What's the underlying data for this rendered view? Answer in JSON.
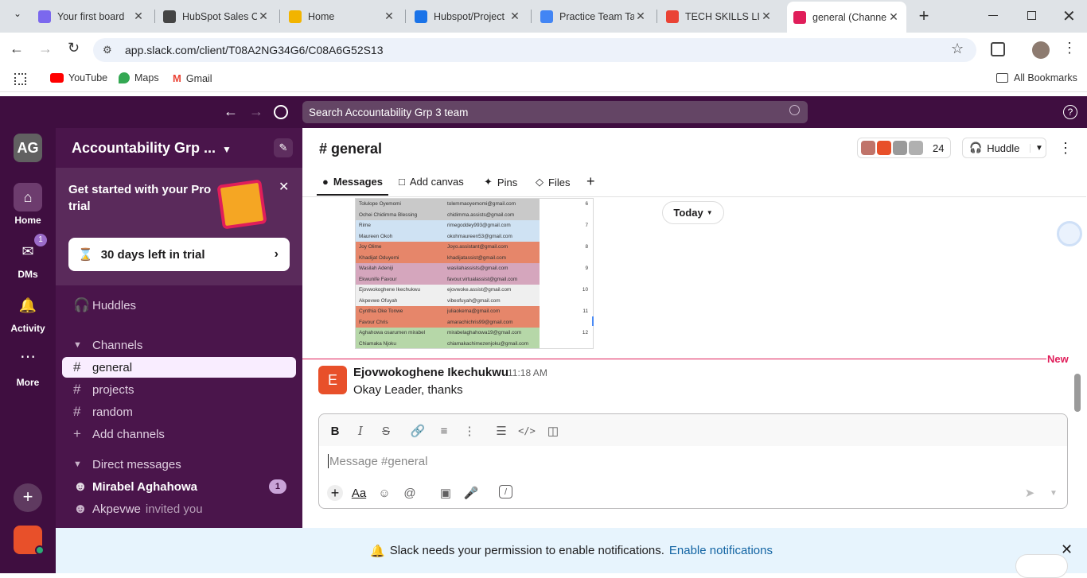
{
  "browser": {
    "tabs": [
      {
        "title": "Your first board",
        "icon_color": "#7b68ee"
      },
      {
        "title": "HubSpot Sales C",
        "icon_color": "#444444"
      },
      {
        "title": "Home",
        "icon_color": "#f2b400"
      },
      {
        "title": "Hubspot/Project",
        "icon_color": "#1a73e8"
      },
      {
        "title": "Practice Team Ta",
        "icon_color": "#4285f4"
      },
      {
        "title": "TECH SKILLS LIN",
        "icon_color": "#ea4335"
      },
      {
        "title": "general (Channe",
        "icon_color": "#e01e5a"
      }
    ],
    "url": "app.slack.com/client/T08A2NG34G6/C08A6G52S13",
    "bookmarks": [
      "YouTube",
      "Maps",
      "Gmail"
    ],
    "all_bookmarks": "All Bookmarks"
  },
  "slack": {
    "search_placeholder": "Search Accountability Grp 3 team",
    "workspace_initials": "AG",
    "workspace_name": "Accountability Grp ...",
    "rail": {
      "home": "Home",
      "dms": "DMs",
      "dms_badge": "1",
      "activity": "Activity",
      "more": "More"
    },
    "promo": {
      "title": "Get started with your Pro trial",
      "trial_label": "30 days left in trial"
    },
    "huddles": "Huddles",
    "channels_header": "Channels",
    "channels": [
      "general",
      "projects",
      "random"
    ],
    "add_channels": "Add channels",
    "dm_header": "Direct messages",
    "dms": [
      {
        "name": "Mirabel Aghahowa",
        "badge": "1",
        "note": ""
      },
      {
        "name": "Akpevwe",
        "badge": "",
        "note": "invited you"
      }
    ],
    "channel": {
      "name": "# general",
      "member_count": "24",
      "huddle": "Huddle"
    },
    "tabs": [
      "Messages",
      "Add canvas",
      "Pins",
      "Files"
    ],
    "date_divider": "Today",
    "new_label": "New",
    "message": {
      "author": "Ejovwokoghene Ikechukwu",
      "avatar": "E",
      "time": "11:18 AM",
      "text": "Okay Leader, thanks"
    },
    "composer_placeholder": "Message #general",
    "notification": {
      "text": "Slack needs your permission to enable notifications.",
      "link": "Enable notifications"
    },
    "sheet_rows": [
      {
        "name": "Tolulope Oyemomi",
        "email": "tolemmaoyemomi@gmail.com",
        "num": "6",
        "color": "#c9c9c9"
      },
      {
        "name": "Ochei Chidimma Blessing",
        "email": "chidimma.assists@gmail.com",
        "num": "",
        "color": "#c9c9c9"
      },
      {
        "name": "Rime",
        "email": "rimegoddey993@gmail.com",
        "num": "7",
        "color": "#cfe2f3"
      },
      {
        "name": "Maureen Okoh",
        "email": "okohmaureen53@gmail.com",
        "num": "",
        "color": "#cfe2f3"
      },
      {
        "name": "Joy Olime",
        "email": "Joyo.assistant@gmail.com",
        "num": "8",
        "color": "#e6866a"
      },
      {
        "name": "Khadijat Oduyemi",
        "email": "khadijatassist@gmail.com",
        "num": "",
        "color": "#e6866a"
      },
      {
        "name": "Wasilah Adeniji",
        "email": "wasilahassists@gmail.com",
        "num": "9",
        "color": "#d5a6bd"
      },
      {
        "name": "Ekwunife Favour",
        "email": "favour.virtualassist@gmail.com",
        "num": "",
        "color": "#d5a6bd"
      },
      {
        "name": "Ejovwokoghene Ikechukwu",
        "email": "ejovwoke.assist@gmail.com",
        "num": "10",
        "color": "#efefef"
      },
      {
        "name": "Akpevwe Ofuyah",
        "email": "vibeofuyah@gmail.com",
        "num": "",
        "color": "#efefef"
      },
      {
        "name": "Cynthia Oke Tonwe",
        "email": "juliaokema@gmail.com",
        "num": "11",
        "color": "#e6866a"
      },
      {
        "name": "Favour Chris",
        "email": "amarachichris99@gmail.com",
        "num": "",
        "color": "#e6866a"
      },
      {
        "name": "Aghahowa osarumen mirabel",
        "email": "mirabelaghahowa19@gmail.com",
        "num": "12",
        "color": "#b6d7a8"
      },
      {
        "name": "Chiamaka Njoku",
        "email": "chiamakachimezenjoku@gmail.com",
        "num": "",
        "color": "#b6d7a8"
      }
    ]
  }
}
